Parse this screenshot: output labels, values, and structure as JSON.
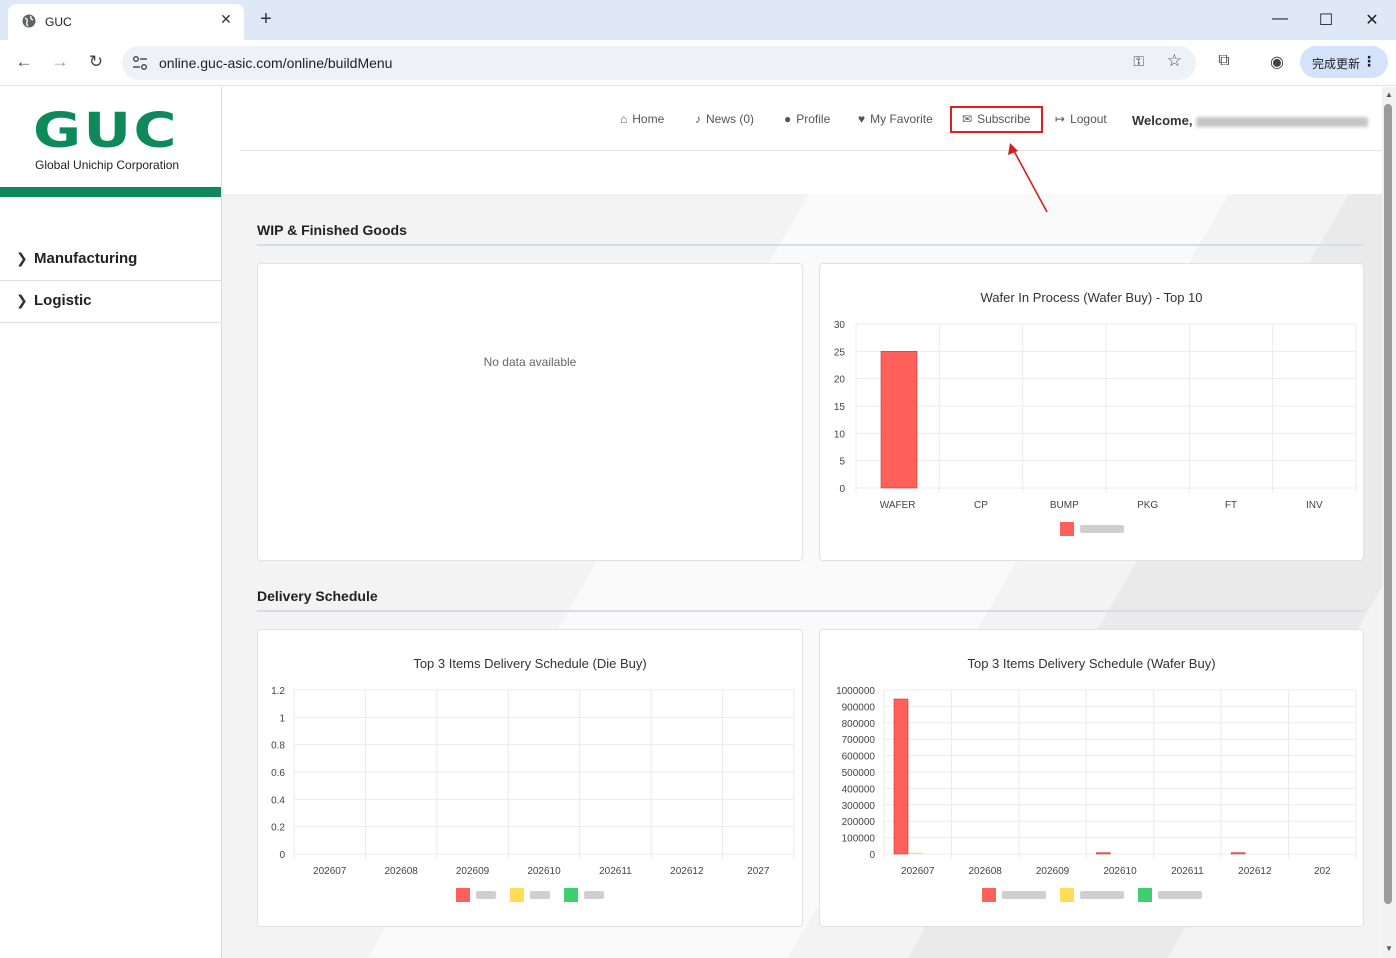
{
  "browser": {
    "tab_title": "GUC",
    "url": "online.guc-asic.com/online/buildMenu",
    "update_label": "完成更新"
  },
  "sidebar": {
    "logo_text": "GUC",
    "logo_subtitle": "Global Unichip Corporation",
    "items": [
      {
        "label": "Manufacturing"
      },
      {
        "label": "Logistic"
      }
    ]
  },
  "header": {
    "nav": [
      {
        "label": "Home",
        "icon": "home-icon"
      },
      {
        "label": "News (0)",
        "icon": "bell-icon"
      },
      {
        "label": "Profile",
        "icon": "user-icon"
      },
      {
        "label": "My Favorite",
        "icon": "heart-icon"
      },
      {
        "label": "Subscribe",
        "icon": "envelope-icon"
      },
      {
        "label": "Logout",
        "icon": "logout-icon"
      }
    ],
    "welcome_label": "Welcome,"
  },
  "sections": {
    "wip_title": "WIP & Finished Goods",
    "delivery_title": "Delivery Schedule"
  },
  "cards": {
    "no_data": "No data available"
  },
  "colors": {
    "brand_green": "#0e8a5a",
    "bar_red": "#ff6059",
    "bar_yellow": "#ffdd57",
    "bar_green": "#3ecf6e",
    "highlight_red": "#e02020"
  },
  "chart_data": [
    {
      "type": "bar",
      "title": "Wafer In Process (Wafer Buy) - Top 10",
      "categories": [
        "WAFER",
        "CP",
        "BUMP",
        "PKG",
        "FT",
        "INV"
      ],
      "series": [
        {
          "values": [
            25,
            0,
            0,
            0,
            0,
            0
          ],
          "color": "#ff6059"
        }
      ],
      "ylim": [
        0,
        30
      ],
      "yticks": [
        "30",
        "25",
        "20",
        "15",
        "10",
        "5",
        "0"
      ],
      "grid": true,
      "legend": "bottom"
    },
    {
      "type": "bar",
      "title": "Top 3 Items Delivery Schedule (Die Buy)",
      "categories": [
        "202607",
        "202608",
        "202609",
        "202610",
        "202611",
        "202612",
        "2027"
      ],
      "series": [
        {
          "values": [
            0,
            0,
            0,
            0,
            0,
            0,
            0
          ],
          "color": "#ff6059"
        },
        {
          "values": [
            0,
            0,
            0,
            0,
            0,
            0,
            0
          ],
          "color": "#ffdd57"
        },
        {
          "values": [
            0,
            0,
            0,
            0,
            0,
            0,
            0
          ],
          "color": "#3ecf6e"
        }
      ],
      "ylim": [
        0,
        1.2
      ],
      "yticks": [
        "1.2",
        "1",
        "0.8",
        "0.6",
        "0.4",
        "0.2",
        "0"
      ],
      "grid": true,
      "legend": "bottom"
    },
    {
      "type": "bar",
      "title": "Top 3 Items Delivery Schedule (Wafer Buy)",
      "categories": [
        "202607",
        "202608",
        "202609",
        "202610",
        "202611",
        "202612",
        "202"
      ],
      "series": [
        {
          "values": [
            945000,
            0,
            0,
            8000,
            0,
            8000,
            0
          ],
          "color": "#ff6059"
        },
        {
          "values": [
            8000,
            0,
            0,
            0,
            0,
            0,
            0
          ],
          "color": "#ffdd57"
        },
        {
          "values": [
            0,
            0,
            0,
            0,
            0,
            0,
            0
          ],
          "color": "#3ecf6e"
        }
      ],
      "ylim": [
        0,
        1000000
      ],
      "yticks": [
        "1000000",
        "900000",
        "800000",
        "700000",
        "600000",
        "500000",
        "400000",
        "300000",
        "200000",
        "100000",
        "0"
      ],
      "grid": true,
      "legend": "bottom"
    }
  ]
}
